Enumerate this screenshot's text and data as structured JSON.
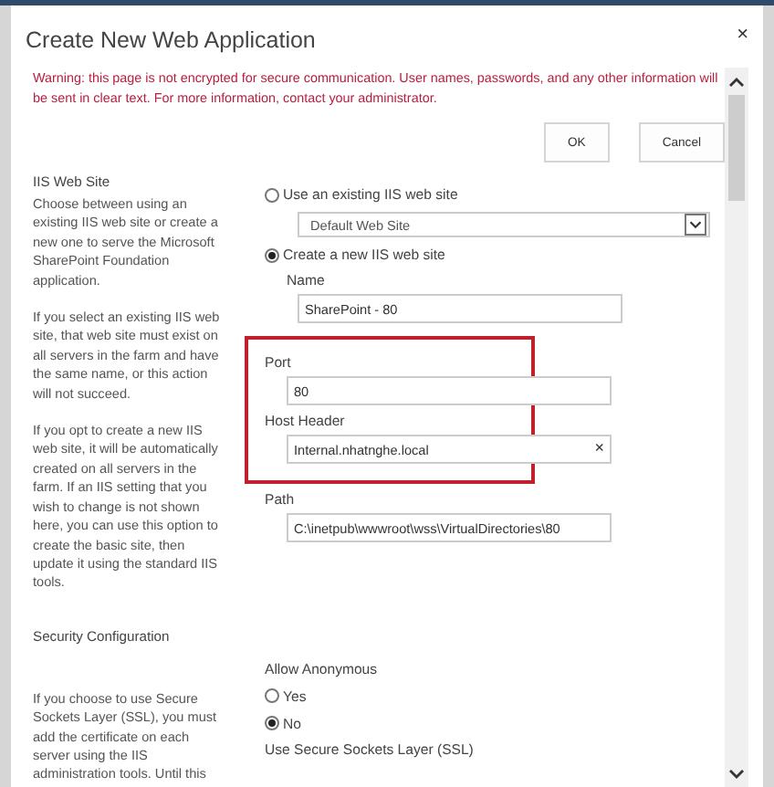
{
  "window": {
    "title": "Create New Web Application",
    "close": "×"
  },
  "warning": "Warning: this page is not encrypted for secure communication. User names, passwords, and any other information will be sent in clear text. For more information, contact your administrator.",
  "buttons": [
    {
      "label": "OK"
    },
    {
      "label": "Cancel"
    }
  ],
  "sections": [
    {
      "heading": "IIS Web Site",
      "paragraphs": [
        "Choose between using an existing IIS web site or create a new one to serve the Microsoft SharePoint Foundation application.",
        "If you select an existing IIS web site, that web site must exist on all servers in the farm and have the same name, or this action will not succeed.",
        "If you opt to create a new IIS web site, it will be automatically created on all servers in the farm.  If an IIS setting that you wish to change is not shown here, you can use this option to create the basic site, then update it using the standard IIS tools."
      ],
      "controls": [
        {
          "kind": "radio",
          "label": "Use an existing IIS web site",
          "selected": false
        },
        {
          "kind": "select",
          "value": "Default Web Site"
        },
        {
          "kind": "radio",
          "label": "Create a new IIS web site",
          "selected": true
        },
        {
          "kind": "subfield",
          "label": "Name",
          "value": "SharePoint - 80"
        },
        {
          "kind": "highlight",
          "children": [
            {
              "kind": "field",
              "label": "Port",
              "value": "80"
            },
            {
              "kind": "field",
              "label": "Host Header",
              "value": "Internal.nhatnghe.local",
              "clear": "×"
            }
          ]
        },
        {
          "kind": "field",
          "label": "Path",
          "value": "C:\\inetpub\\wwwroot\\wss\\VirtualDirectories\\80"
        }
      ]
    },
    {
      "heading": "Security Configuration",
      "paragraphs": [
        "If you choose to use Secure Sockets Layer (SSL), you must add the certificate on each server using the IIS administration tools.  Until this"
      ],
      "controls": [
        {
          "kind": "label",
          "label": "Allow Anonymous"
        },
        {
          "kind": "radio",
          "label": "Yes",
          "selected": false
        },
        {
          "kind": "radio",
          "label": "No",
          "selected": true
        },
        {
          "kind": "label",
          "label": "Use Secure Sockets Layer (SSL)"
        }
      ]
    }
  ]
}
